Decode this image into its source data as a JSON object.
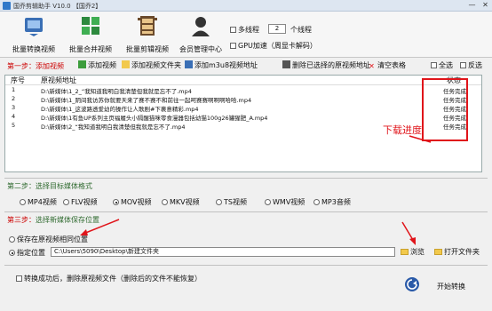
{
  "window": {
    "title": "国乔剪辑助手 V10.0 【国乔2】",
    "minimize": "—",
    "close": "✕"
  },
  "toolbar": {
    "items": [
      {
        "label": "批量转换视频",
        "icon": "convert-icon"
      },
      {
        "label": "批量合并视频",
        "icon": "merge-icon"
      },
      {
        "label": "批量剪辑视频",
        "icon": "film-icon"
      },
      {
        "label": "会员管理中心",
        "icon": "member-icon"
      }
    ],
    "multithread_label": "多线程",
    "thread_count": "2",
    "thread_unit": "个线程",
    "gpu_label": "GPU加速（周显卡解码）"
  },
  "step1": {
    "label": "第一步：",
    "title": "添加视频",
    "actions": [
      {
        "label": "添加视频",
        "icon": "add-video-icon"
      },
      {
        "label": "添加视频文件夹",
        "icon": "add-folder-icon"
      },
      {
        "label": "添加m3u8视频地址",
        "icon": "add-link-icon"
      },
      {
        "label": "删除已选择的原视频地址",
        "icon": "delete-icon"
      },
      {
        "label": "清空表格",
        "icon": "clear-icon"
      }
    ],
    "select_all": "全选",
    "invert": "反选"
  },
  "list": {
    "columns": [
      "序号",
      "原视频地址",
      "状态"
    ],
    "rows": [
      {
        "no": "1",
        "path": "D:\\新媒体\\1_2_“我知道我明白我清楚但我就是忘不了.mp4",
        "status": "任务完成"
      },
      {
        "no": "2",
        "path": "D:\\新媒体\\1_阴间我访苏你就要天来了赛不赛不和前往一起呵赛赛啊啊啊哈哈.mp4",
        "status": "任务完成"
      },
      {
        "no": "3",
        "path": "D:\\新媒体\\1_这波路透爱幼的操作让人歌剧#下裹意精彩.mp4",
        "status": "任务完成"
      },
      {
        "no": "4",
        "path": "D:\\新媒体\\1有鱼UP系列主页福履头小隔醒猫咪零食漫器包括幼猫100g26罐猩肥_A.mp4",
        "status": "任务完成"
      },
      {
        "no": "5",
        "path": "D:\\新媒体\\2_“我知道我明白我清楚但我就是忘不了.mp4",
        "status": "任务完成"
      }
    ],
    "annotation": "下载进度"
  },
  "step2": {
    "label": "第二步：",
    "title": "选择目标媒体格式",
    "formats": [
      "MP4视频",
      "FLV视频",
      "MOV视频",
      "MKV视频",
      "TS视频",
      "WMV视频",
      "MP3音频"
    ],
    "selected": "MOV视频"
  },
  "step3": {
    "label": "第三步：",
    "title": "选择新媒体保存位置",
    "save_same": "保存在原视频相同位置",
    "specify": "指定位置",
    "path": "C:\\Users\\5090\\Desktop\\新建文件夹",
    "browse": "浏览",
    "open_folder": "打开文件夹"
  },
  "bottom": {
    "delete_after": "转换成功后，删除原视频文件（删除后的文件不能恢复）",
    "start": "开始转换"
  },
  "colors": {
    "accent_red": "#e0141a",
    "step_green": "#2f6a2f",
    "titlebar": "#dde6f1"
  }
}
